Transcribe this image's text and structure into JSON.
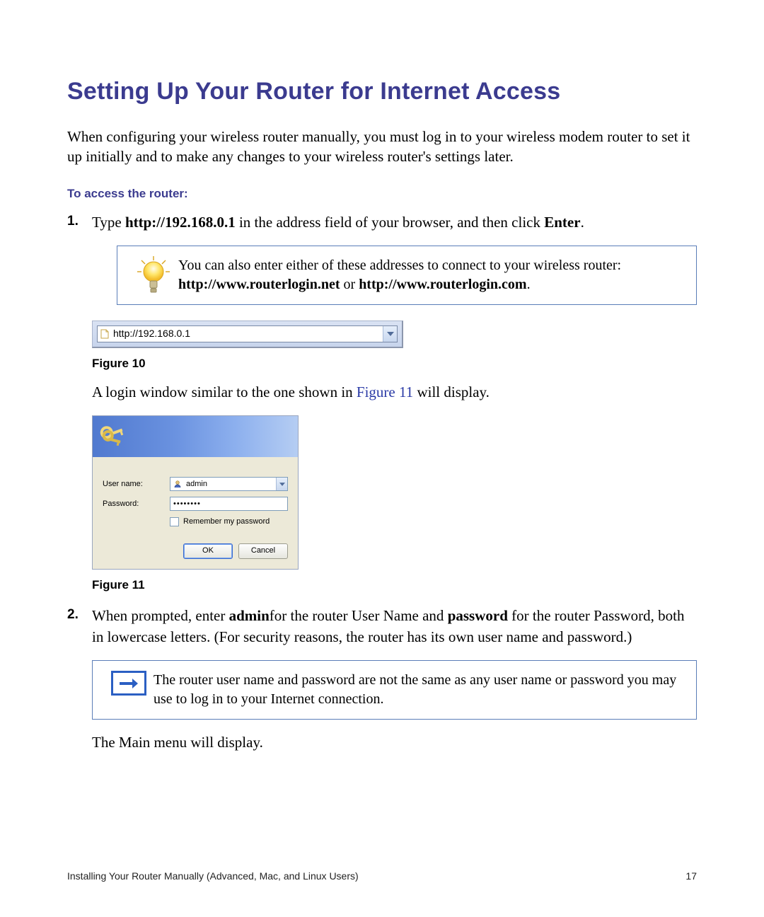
{
  "heading": "Setting Up Your Router for Internet Access",
  "intro": "When configuring your wireless router manually, you must log in to your wireless modem router to set it up initially and to make any changes to your wireless router's settings later.",
  "subhead": "To access the router:",
  "step1": {
    "pre": "Type ",
    "url": "http://192.168.0.1",
    "mid": " in the address field of your browser, and then click ",
    "action": "Enter",
    "post": "."
  },
  "tip": {
    "line1": "You can also enter either of these addresses to connect to your wireless router:",
    "url1": "http://www.routerlogin.net",
    "or": " or ",
    "url2": "http://www.routerlogin.com",
    "period": "."
  },
  "addressbar": {
    "url": "http://192.168.0.1"
  },
  "figure10": "Figure 10",
  "after_fig10": {
    "pre": "A login window similar to the one shown in ",
    "link": "Figure 11",
    "post": " will display."
  },
  "login": {
    "user_label": "User name:",
    "pass_label": "Password:",
    "user_value": "admin",
    "pass_bullets": "••••••••",
    "remember": "Remember my password",
    "ok": "OK",
    "cancel": "Cancel"
  },
  "figure11": "Figure 11",
  "step2": {
    "pre": "When prompted, enter ",
    "b1": "admin",
    "mid1": "for the router User Name and ",
    "b2": "password",
    "post": " for the router Password, both in lowercase letters. (For security reasons, the router has its own user name and password.)"
  },
  "note": "The router user name and password are not the same as any user name or password you may use to log in to your Internet connection.",
  "mainmenu": "The Main menu will display.",
  "footer_left": "Installing Your Router Manually (Advanced, Mac, and Linux Users)",
  "footer_right": "17"
}
